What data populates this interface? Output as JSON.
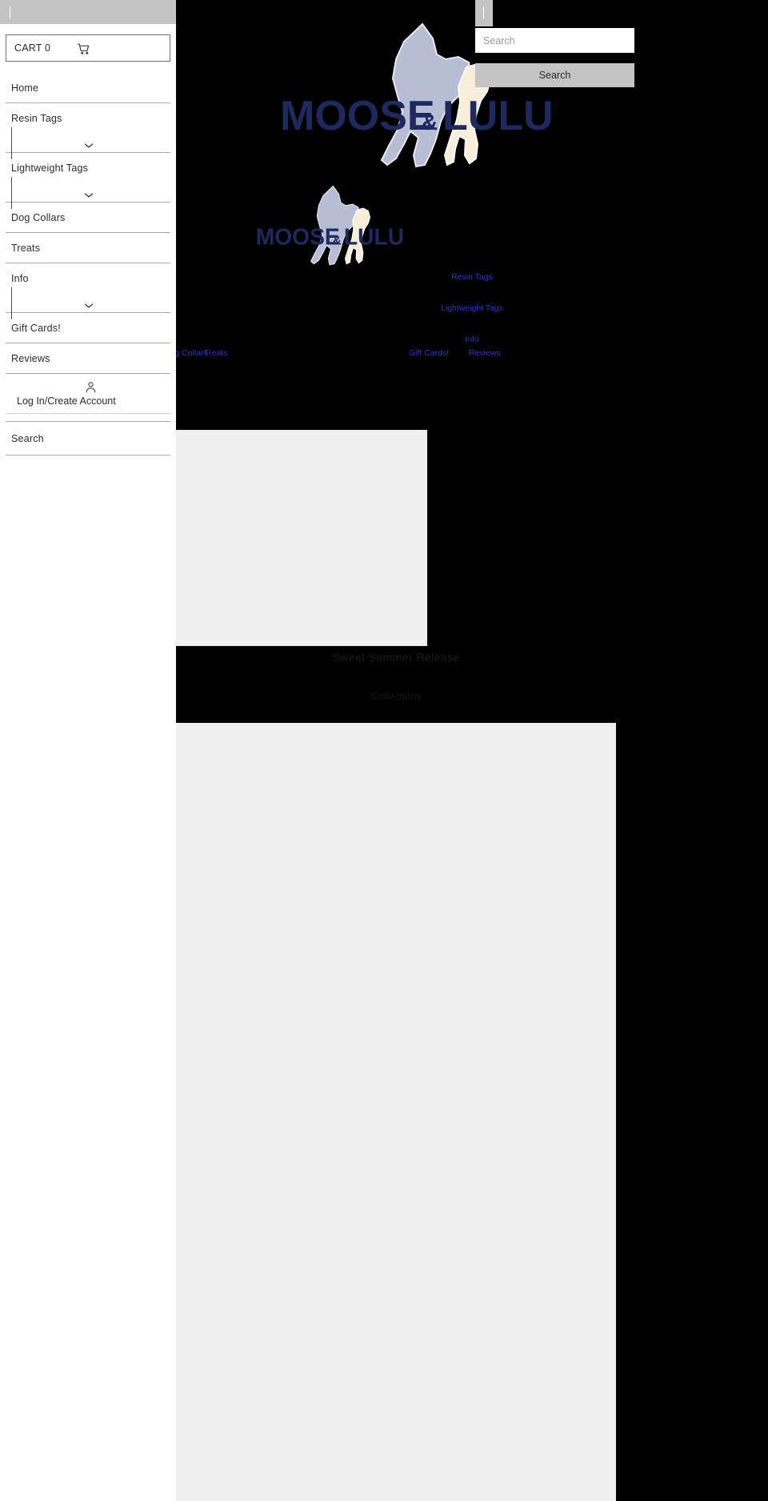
{
  "site": {
    "brand_name": "MOOSE & LULU'S",
    "brand_color": "#1e2a5e",
    "background_color": "#000000",
    "link_color": "#3333cc"
  },
  "drawer": {
    "toggle_icon": "vertical-bar-icon",
    "cart": {
      "label": "CART 0",
      "icon": "shopping-cart-icon"
    },
    "items": [
      {
        "label": "Home",
        "has_submenu": false
      },
      {
        "label": "Resin Tags",
        "has_submenu": true,
        "chevron_icon": "chevron-down-icon"
      },
      {
        "label": "Lightweight Tags",
        "has_submenu": true,
        "chevron_icon": "chevron-down-icon"
      },
      {
        "label": "Dog Collars",
        "has_submenu": false
      },
      {
        "label": "Treats",
        "has_submenu": false
      },
      {
        "label": "Info",
        "has_submenu": true,
        "chevron_icon": "chevron-down-icon"
      },
      {
        "label": "Gift Cards!",
        "has_submenu": false
      },
      {
        "label": "Reviews",
        "has_submenu": false
      }
    ],
    "account": {
      "label": "Log In/Create Account",
      "icon": "person-icon"
    },
    "search_label": "Search"
  },
  "search_panel": {
    "toggle_icon": "vertical-bar-icon",
    "input_placeholder": "Search",
    "input_value": "",
    "button_label": "Search"
  },
  "header_nav": {
    "stacked_links": [
      "Resin Tags",
      "Lightweight Tags",
      "Info"
    ],
    "inline_links": [
      "Dog Collars",
      "Treats",
      "Gift Cards!",
      "Reviews"
    ]
  },
  "hero": {
    "title": "Sweet Summer Release",
    "subtitle": "Collections"
  }
}
